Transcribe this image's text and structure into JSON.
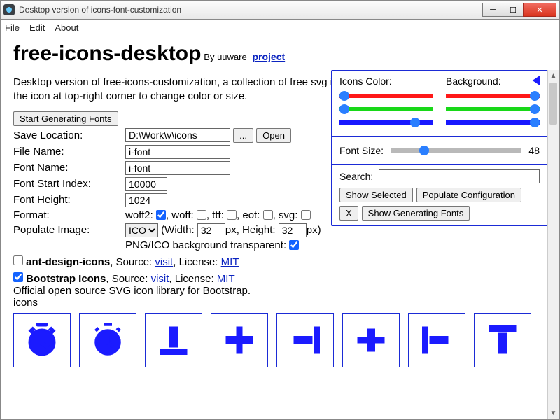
{
  "window": {
    "title": "Desktop version of icons-font-customization",
    "menu": {
      "file": "File",
      "edit": "Edit",
      "about": "About"
    }
  },
  "header": {
    "title": "free-icons-desktop",
    "by": "By uuware",
    "project_link": "project"
  },
  "desc": "Desktop version of free-icons-customization, a collection of free svg icons and tool of generating icon font. Click on the icon at top-right corner to change color or size.",
  "buttons": {
    "start_gen": "Start Generating Fonts",
    "browse": "...",
    "open": "Open"
  },
  "form": {
    "save_loc_label": "Save Location:",
    "save_loc": "D:\\Work\\v\\icons",
    "file_name_label": "File Name:",
    "file_name": "i-font",
    "font_name_label": "Font Name:",
    "font_name": "i-font",
    "font_start_label": "Font Start Index:",
    "font_start": "10000",
    "font_height_label": "Font Height:",
    "font_height": "1024",
    "format_label": "Format:",
    "format_woff2": "woff2:",
    "format_woff": ", woff:",
    "format_ttf": ", ttf:",
    "format_eot": ", eot:",
    "format_svg": ", svg:",
    "pop_img_label": "Populate Image:",
    "pop_img_sel": "ICO",
    "width_lbl": "(Width:",
    "width_val": "32",
    "px_h": "px, Height:",
    "height_val": "32",
    "px_close": "px)",
    "png_bg": "PNG/ICO background transparent:"
  },
  "sets": {
    "ant": {
      "name": "ant-design-icons",
      "source": ", Source:",
      "visit": "visit",
      "license_lbl": ", License:",
      "license": "MIT"
    },
    "bs": {
      "name": "Bootstrap Icons",
      "source": ", Source:",
      "visit": "visit",
      "license_lbl": ", License:",
      "license": "MIT",
      "desc": "Official open source SVG icon library for Bootstrap.",
      "sub": "icons"
    }
  },
  "panel": {
    "icons_color": "Icons Color:",
    "background": "Background:",
    "font_size_lbl": "Font Size:",
    "font_size_val": "48",
    "search_lbl": "Search:",
    "show_selected": "Show Selected",
    "populate_conf": "Populate Configuration",
    "x": "X",
    "show_gen": "Show Generating Fonts",
    "sliders": {
      "icons": {
        "r": 0,
        "g": 0,
        "b": 75
      },
      "bg": {
        "r": 100,
        "g": 100,
        "b": 100
      },
      "size": 22
    }
  },
  "icons": [
    "alarm-fill",
    "alarm",
    "align-bottom",
    "align-center",
    "align-end",
    "align-middle",
    "align-start",
    "align-top"
  ]
}
